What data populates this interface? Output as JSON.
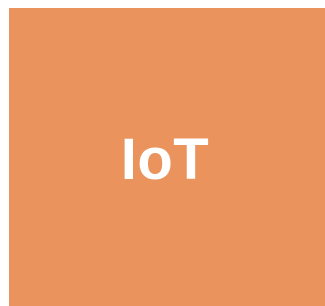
{
  "tile": {
    "label": "IoT",
    "background_color": "#EA935D",
    "text_color": "#FFFFFF"
  }
}
